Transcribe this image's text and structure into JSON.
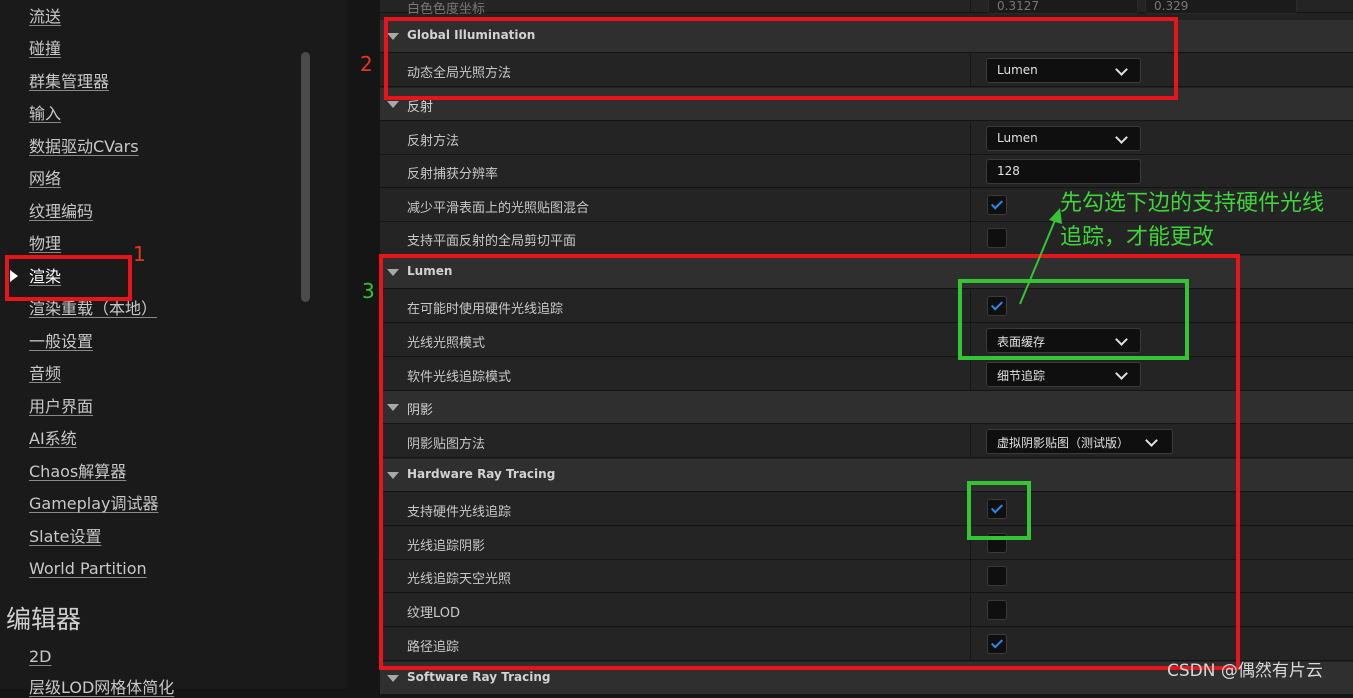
{
  "sidebar": {
    "items": [
      {
        "label": "流送"
      },
      {
        "label": "碰撞"
      },
      {
        "label": "群集管理器"
      },
      {
        "label": "输入"
      },
      {
        "label": "数据驱动CVars"
      },
      {
        "label": "网络"
      },
      {
        "label": "纹理编码"
      },
      {
        "label": "物理"
      },
      {
        "label": "渲染",
        "selected": true
      },
      {
        "label": "渲染重载（本地）"
      },
      {
        "label": "一般设置"
      },
      {
        "label": "音频"
      },
      {
        "label": "用户界面"
      },
      {
        "label": "AI系统"
      },
      {
        "label": "Chaos解算器"
      },
      {
        "label": "Gameplay调试器"
      },
      {
        "label": "Slate设置"
      },
      {
        "label": "World Partition"
      }
    ],
    "editor_section_title": "编辑器",
    "editor_items": [
      {
        "label": "2D"
      },
      {
        "label": "层级LOD网格体简化"
      }
    ]
  },
  "panel": {
    "top_row": {
      "label": "白色色度坐标",
      "x_value": "0.3127",
      "y_value": "0.329"
    },
    "global_illumination": {
      "title": "Global Illumination",
      "dynamic_gi_label": "动态全局光照方法",
      "dynamic_gi_value": "Lumen"
    },
    "reflections": {
      "title": "反射",
      "method_label": "反射方法",
      "method_value": "Lumen",
      "capture_res_label": "反射捕获分辨率",
      "capture_res_value": "128",
      "reduce_lightmap_label": "减少平滑表面上的光照贴图混合",
      "reduce_lightmap_checked": true,
      "clip_plane_label": "支持平面反射的全局剪切平面",
      "clip_plane_checked": false
    },
    "lumen": {
      "title": "Lumen",
      "use_hw_rt_label": "在可能时使用硬件光线追踪",
      "use_hw_rt_checked": true,
      "ray_lighting_label": "光线光照模式",
      "ray_lighting_value": "表面缓存",
      "sw_rt_mode_label": "软件光线追踪模式",
      "sw_rt_mode_value": "细节追踪"
    },
    "shadows": {
      "title": "阴影",
      "shadow_map_label": "阴影贴图方法",
      "shadow_map_value": "虚拟阴影贴图（测试版）"
    },
    "hardware_rt": {
      "title": "Hardware Ray Tracing",
      "support_hw_rt_label": "支持硬件光线追踪",
      "support_hw_rt_checked": true,
      "rt_shadows_label": "光线追踪阴影",
      "rt_shadows_checked": false,
      "rt_skylight_label": "光线追踪天空光照",
      "rt_skylight_checked": false,
      "texture_lod_label": "纹理LOD",
      "texture_lod_checked": false,
      "path_tracing_label": "路径追踪",
      "path_tracing_checked": true
    },
    "software_rt": {
      "title": "Software Ray Tracing"
    }
  },
  "annotations": {
    "num1": "1",
    "num2": "2",
    "num3": "3",
    "note": "先勾选下边的支持硬件光线追踪，才能更改",
    "red_color": "#e8141b",
    "green_color": "#35c434",
    "num1_color": "#e8361b",
    "num2_color": "#e8361b",
    "num3_color": "#35c434"
  },
  "watermark": "CSDN @偶然有片云"
}
